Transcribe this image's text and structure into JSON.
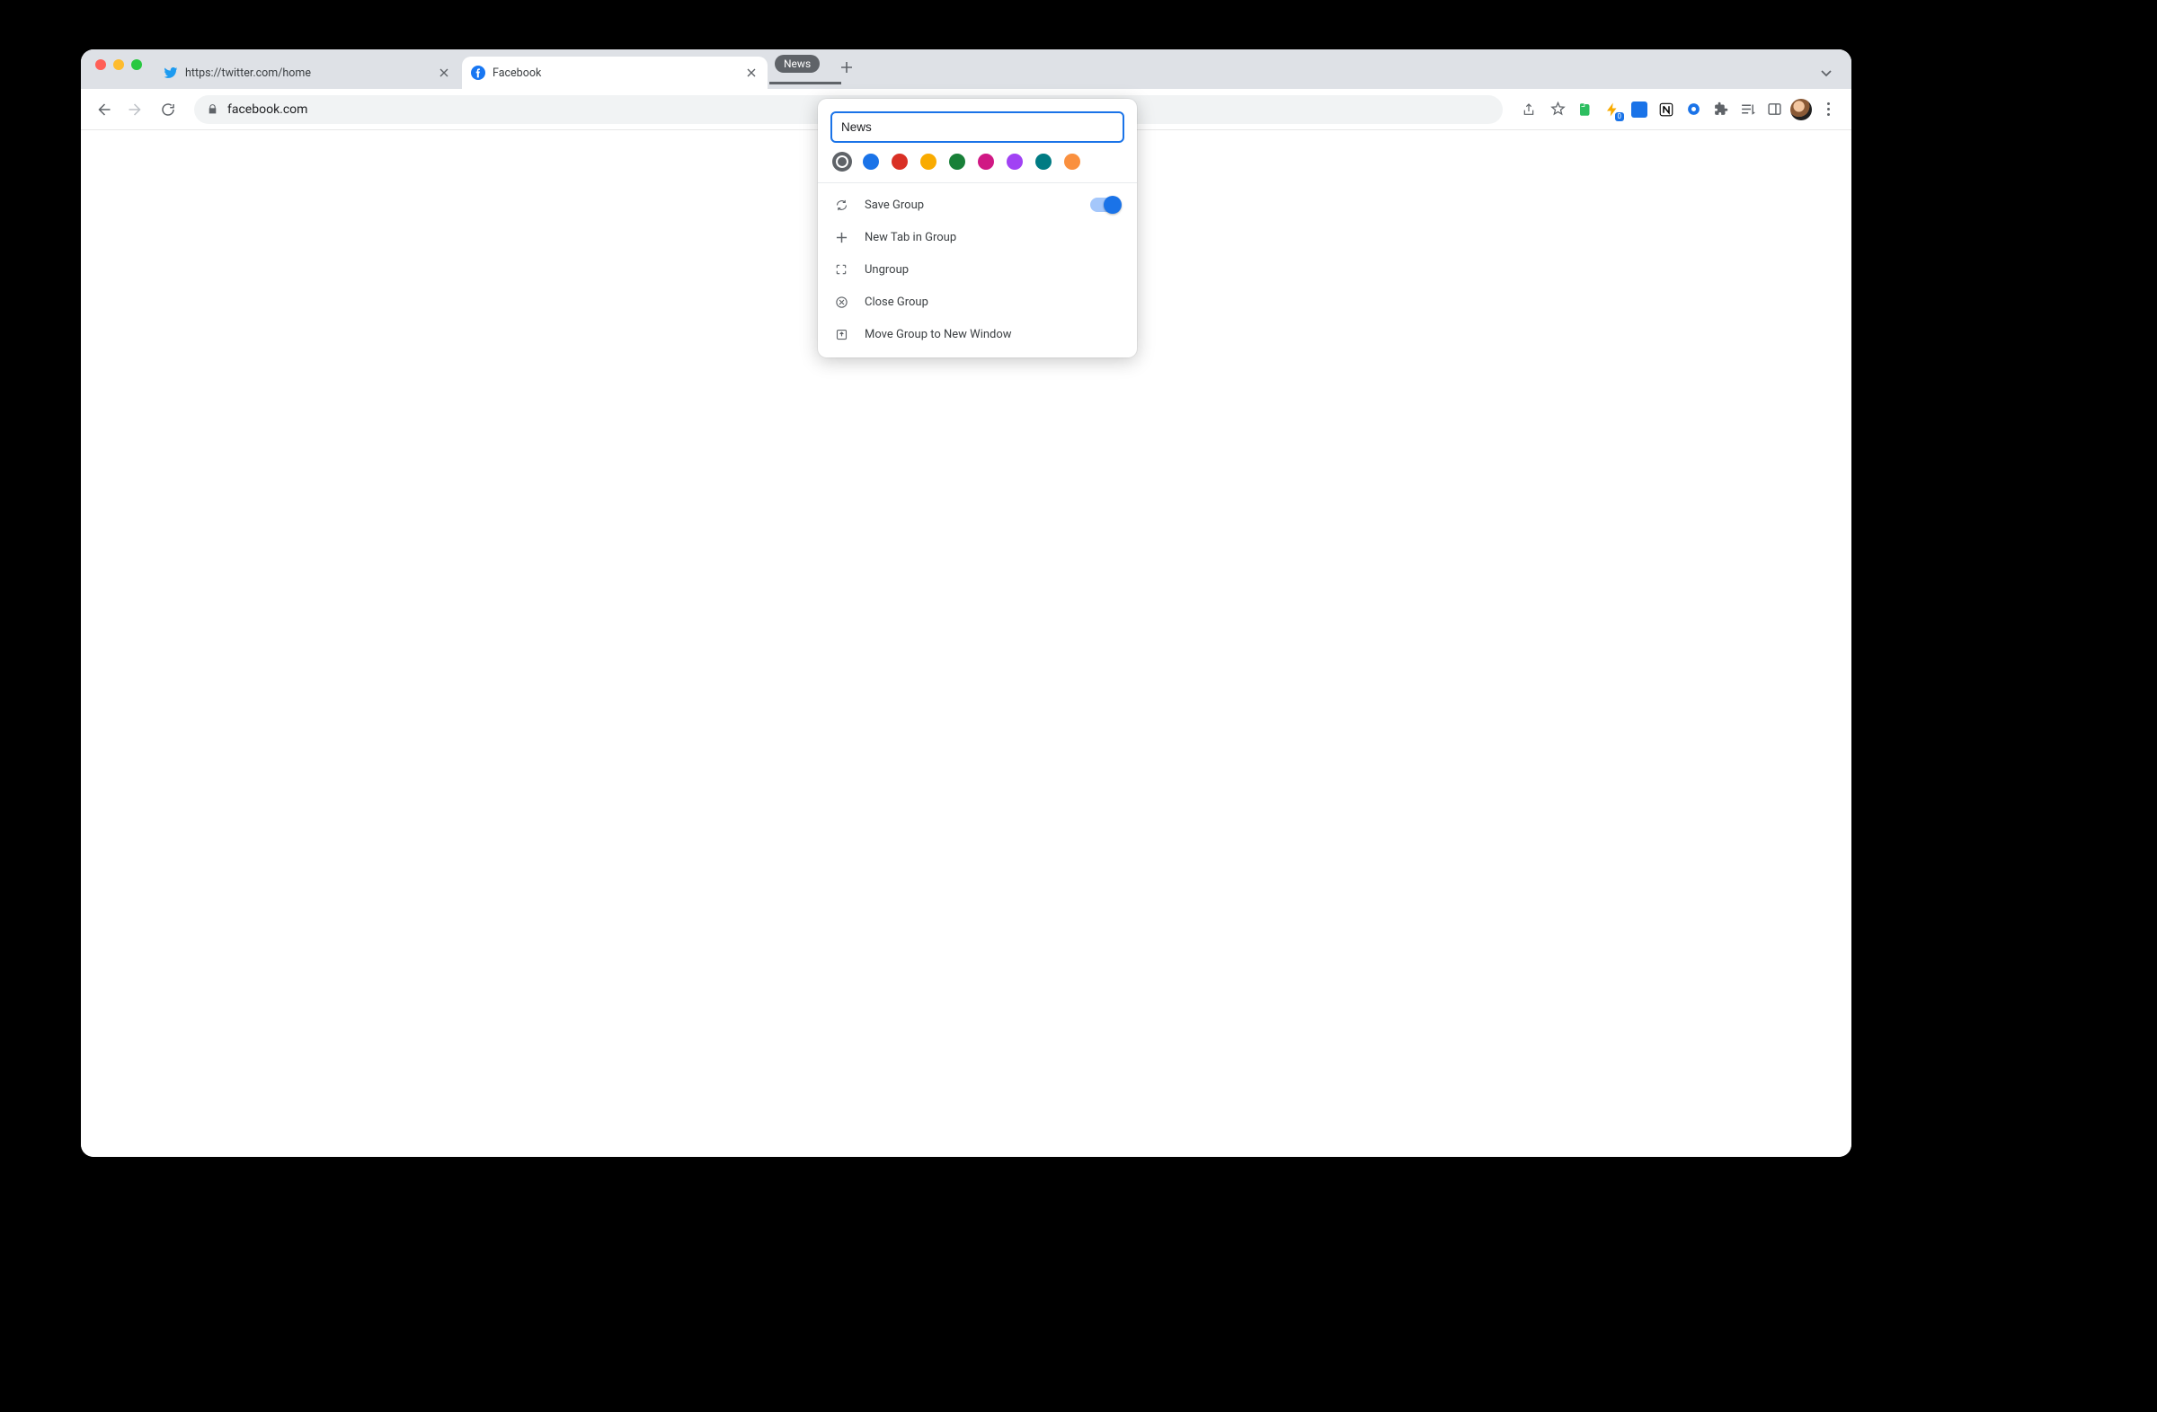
{
  "tabs": [
    {
      "title": "https://twitter.com/home"
    },
    {
      "title": "Facebook"
    }
  ],
  "group_pill": {
    "label": "News"
  },
  "omnibox": {
    "url": "facebook.com"
  },
  "popup": {
    "name_value": "News",
    "colors": {
      "grey": "#5f6368",
      "blue": "#1a73e8",
      "red": "#d93025",
      "yellow": "#f9ab00",
      "green": "#188038",
      "pink": "#d01884",
      "purple": "#a142f4",
      "cyan": "#007b83",
      "orange": "#fa903e"
    },
    "menu": {
      "save_group": "Save Group",
      "new_tab": "New Tab in Group",
      "ungroup": "Ungroup",
      "close_group": "Close Group",
      "move_window": "Move Group to New Window"
    },
    "save_group_toggle": true
  },
  "extension_badge": "0"
}
